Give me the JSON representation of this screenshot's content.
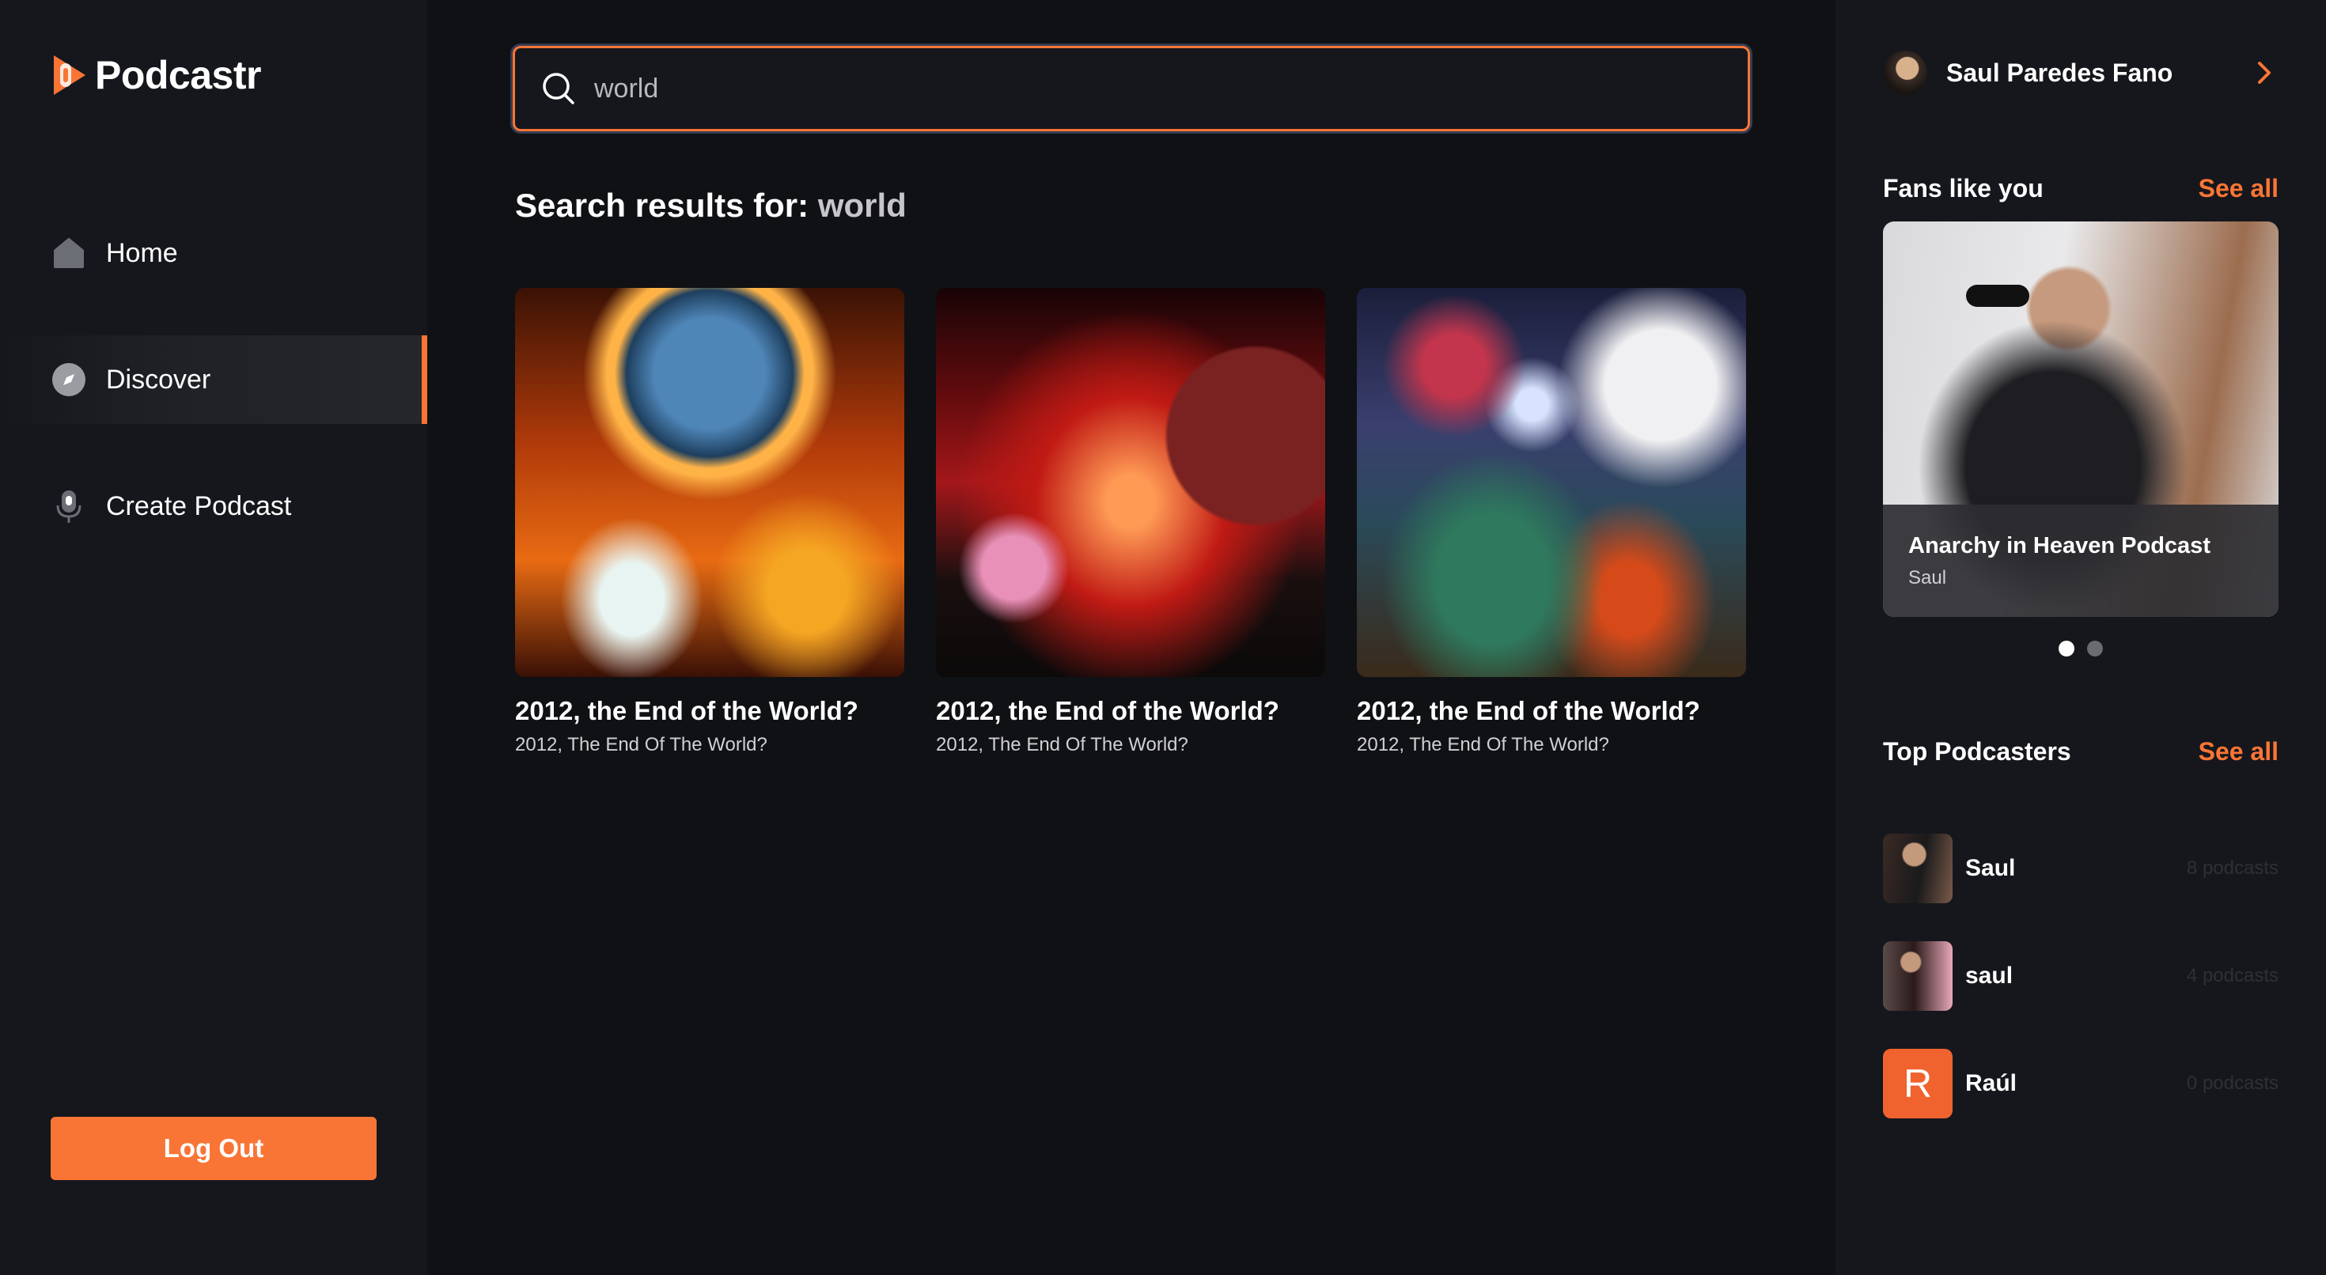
{
  "app": {
    "name": "Podcastr"
  },
  "nav": {
    "items": [
      {
        "label": "Home",
        "icon": "home-icon",
        "active": false
      },
      {
        "label": "Discover",
        "icon": "compass-icon",
        "active": true
      },
      {
        "label": "Create Podcast",
        "icon": "microphone-icon",
        "active": false
      }
    ]
  },
  "logout": {
    "label": "Log Out"
  },
  "search": {
    "value": "world"
  },
  "results": {
    "title_prefix": "Search results for:",
    "query": "world",
    "items": [
      {
        "title": "2012, the End of the World?",
        "subtitle": "2012, The End Of The World?"
      },
      {
        "title": "2012, the End of the World?",
        "subtitle": "2012, The End Of The World?"
      },
      {
        "title": "2012, the End of the World?",
        "subtitle": "2012, The End Of The World?"
      }
    ]
  },
  "user": {
    "name": "Saul Paredes Fano"
  },
  "fans": {
    "title": "Fans like you",
    "see_all": "See all",
    "card": {
      "title": "Anarchy in Heaven Podcast",
      "author": "Saul"
    },
    "slides": 2,
    "active_slide": 1
  },
  "top_podcasters": {
    "title": "Top Podcasters",
    "see_all": "See all",
    "items": [
      {
        "name": "Saul",
        "count": "8 podcasts",
        "avatar": ""
      },
      {
        "name": "saul",
        "count": "4 podcasts",
        "avatar": ""
      },
      {
        "name": "Raúl",
        "count": "0 podcasts",
        "avatar": "R"
      }
    ]
  },
  "colors": {
    "accent": "#f97535",
    "background": "#101114",
    "panel": "#15171c"
  }
}
